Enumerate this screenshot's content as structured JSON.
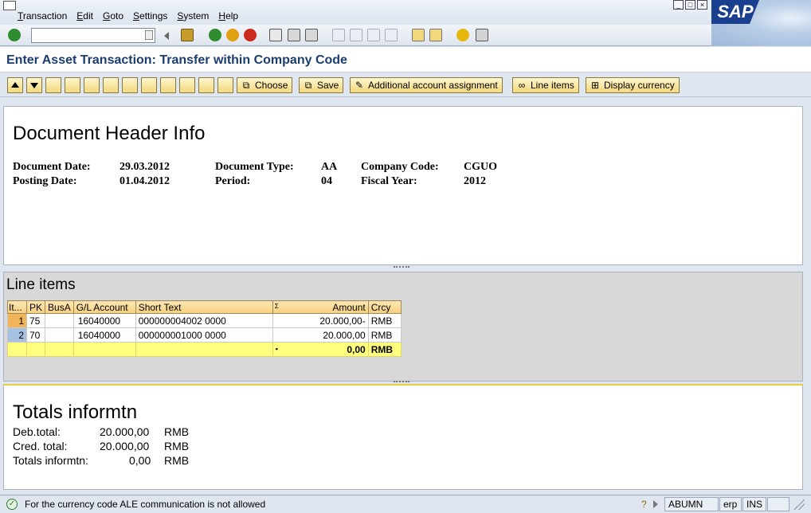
{
  "menu": [
    "Transaction",
    "Edit",
    "Goto",
    "Settings",
    "System",
    "Help"
  ],
  "brand": "SAP",
  "title": "Enter Asset Transaction: Transfer within Company Code",
  "toolbar": {
    "choose": "Choose",
    "save": "Save",
    "additional": "Additional account assignment",
    "line_items": "Line items",
    "display_currency": "Display currency"
  },
  "header": {
    "title": "Document Header Info",
    "document_date_label": "Document Date:",
    "document_date": "29.03.2012",
    "posting_date_label": "Posting Date:",
    "posting_date": "01.04.2012",
    "document_type_label": "Document Type:",
    "document_type": "AA",
    "period_label": "Period:",
    "period": "04",
    "company_code_label": "Company Code:",
    "company_code": "CGUO",
    "fiscal_year_label": "Fiscal Year:",
    "fiscal_year": "2012"
  },
  "line_items": {
    "title": "Line items",
    "columns": [
      "It...",
      "PK",
      "BusA",
      "G/L Account",
      "Short Text",
      "Amount",
      "Crcy"
    ],
    "sum_marker": "Σ",
    "rows": [
      {
        "item": "1",
        "pk": "75",
        "busa": "",
        "gl": "16040000",
        "text": "000000004002 0000",
        "amount": "20.000,00-",
        "crcy": "RMB"
      },
      {
        "item": "2",
        "pk": "70",
        "busa": "",
        "gl": "16040000",
        "text": "000000001000 0000",
        "amount": "20.000,00",
        "crcy": "RMB"
      }
    ],
    "total": {
      "marker": "▪",
      "amount": "0,00",
      "crcy": "RMB"
    }
  },
  "totals": {
    "title": "Totals informtn",
    "rows": [
      {
        "label": "Deb.total:",
        "value": "20.000,00",
        "crcy": "RMB"
      },
      {
        "label": "Cred. total:",
        "value": "20.000,00",
        "crcy": "RMB"
      },
      {
        "label": "Totals informtn:",
        "value": "0,00",
        "crcy": "RMB"
      }
    ]
  },
  "status": {
    "message": "For the currency code  ALE communication is not allowed",
    "user": "ABUMN",
    "system": "erp",
    "mode": "INS"
  },
  "colors": {
    "accent": "#1b3c6e",
    "button": "#f2d77d",
    "total_row": "#ffff7f"
  }
}
